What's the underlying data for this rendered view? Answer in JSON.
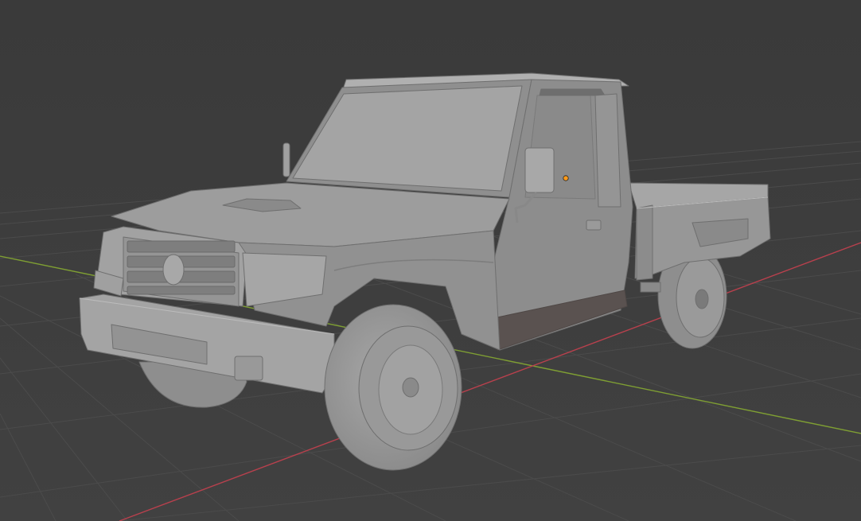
{
  "viewport": {
    "background_color": "#3d3d3d",
    "grid_color": "#4a4a4a",
    "x_axis_color": "#b8404d",
    "y_axis_color": "#7f9f33",
    "model_base_color": "#9d9d9d",
    "model_shadow_color": "#777777",
    "model_highlight_color": "#b3b3b3",
    "rocker_color": "#5a5250",
    "origin_color": "#ff9a1a"
  },
  "scene": {
    "object_type": "pickup-truck",
    "origin_marker": "object-origin-dot"
  }
}
